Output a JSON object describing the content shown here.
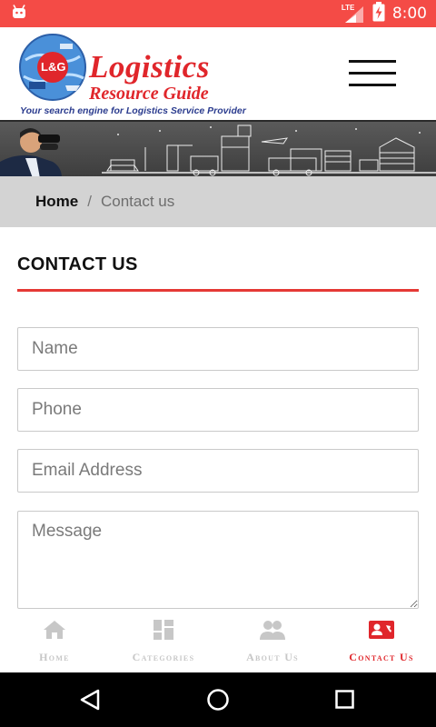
{
  "status_bar": {
    "time": "8:00",
    "network": "LTE",
    "color": "#f44b46"
  },
  "header": {
    "logo_title": "Logistics",
    "logo_subtitle": "Resource Guide",
    "logo_tagline": "Your search engine for Logistics Service Provider",
    "logo_badge": "L&G",
    "brand_color": "#e0262b"
  },
  "breadcrumb": {
    "home": "Home",
    "separator": "/",
    "current": "Contact us"
  },
  "page": {
    "title": "CONTACT US",
    "accent_color": "#e53935"
  },
  "form": {
    "name_placeholder": "Name",
    "phone_placeholder": "Phone",
    "email_placeholder": "Email Address",
    "message_placeholder": "Message"
  },
  "bottom_nav": {
    "items": [
      {
        "label": "Home",
        "icon": "home-icon",
        "active": false
      },
      {
        "label": "Categories",
        "icon": "grid-icon",
        "active": false
      },
      {
        "label": "About Us",
        "icon": "people-icon",
        "active": false
      },
      {
        "label": "Contact Us",
        "icon": "contact-card-icon",
        "active": true
      }
    ],
    "active_color": "#e0262b",
    "inactive_color": "#c7c7c7"
  },
  "system_nav": {
    "buttons": [
      "back-icon",
      "home-circle-icon",
      "recents-icon"
    ]
  }
}
